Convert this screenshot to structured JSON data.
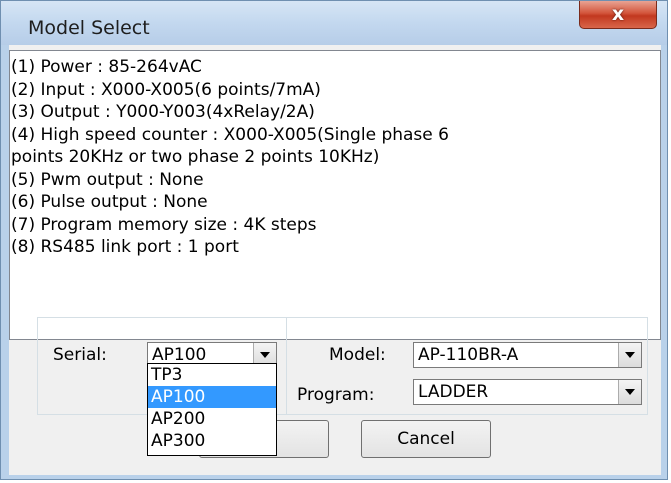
{
  "window": {
    "title": "Model Select",
    "close_glyph": "x"
  },
  "info": {
    "lines": [
      "(1) Power : 85-264vAC",
      "(2) Input : X000-X005(6 points/7mA)",
      "(3) Output : Y000-Y003(4xRelay/2A)",
      "(4) High speed counter : X000-X005(Single phase 6",
      "points 20KHz or two phase 2 points 10KHz)",
      "(5) Pwm output : None",
      "(6) Pulse output : None",
      "(7) Program memory size : 4K steps",
      "(8) RS485 link port : 1 port"
    ]
  },
  "serial": {
    "label": "Serial:",
    "value": "AP100",
    "options": [
      "TP3",
      "AP100",
      "AP200",
      "AP300"
    ],
    "selected_index": 1
  },
  "model": {
    "label": "Model:",
    "value": "AP-110BR-A"
  },
  "program": {
    "label": "Program:",
    "value": "LADDER"
  },
  "buttons": {
    "ok_label": "",
    "cancel_label": "Cancel"
  },
  "colors": {
    "selection": "#3399ff",
    "close_button": "#c2381f",
    "window_frame": "#b9d1ea"
  },
  "icons": {
    "close": "close-icon",
    "combo_arrow": "chevron-down-icon"
  }
}
